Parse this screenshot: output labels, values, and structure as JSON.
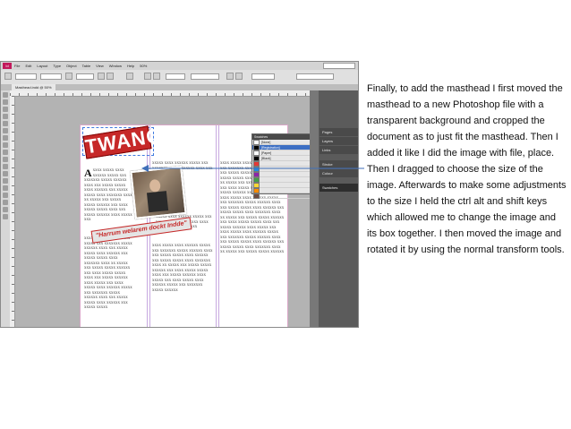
{
  "slide": {
    "note": "Finally, to add the masthead I first moved the masthead to a new Photoshop file with a transparent background and cropped the document as to just fit the masthead. Then I added it like I did the image with file, place. Then I dragged to choose the size of the image. Afterwards to make some adjustments to the size I held the ctrl alt and shift keys which allowed me to change the image and its box together. I then moved the image and rotated it by using the normal transform tools."
  },
  "app": {
    "logo": "Id",
    "menu": [
      "File",
      "Edit",
      "Layout",
      "Type",
      "Object",
      "Table",
      "View",
      "Window",
      "Help"
    ],
    "doc_tab": "Masthead.indd @ 50%",
    "zoom": "50%"
  },
  "page": {
    "masthead": "TWANG",
    "quote": "\"Harrum welarem dockt Indde\""
  },
  "swatches": {
    "title": "Swatches",
    "rows": [
      "[None]",
      "[Registration]",
      "[Paper]",
      "[Black]",
      "",
      "",
      "",
      "",
      "",
      "",
      ""
    ],
    "colors": [
      "#ffffff",
      "#000000",
      "#ffffff",
      "#000000",
      "#e53935",
      "#1e88e5",
      "#8e24aa",
      "#43a047",
      "#fdd835",
      "#fb8c00",
      "#6d4c41"
    ]
  },
  "panels": {
    "items": [
      "Pages",
      "Layers",
      "Links",
      "Stroke",
      "Colour",
      "Swatches"
    ]
  },
  "colors": {
    "accent_red": "#c62828",
    "arrow_blue": "#3f6fb8"
  }
}
